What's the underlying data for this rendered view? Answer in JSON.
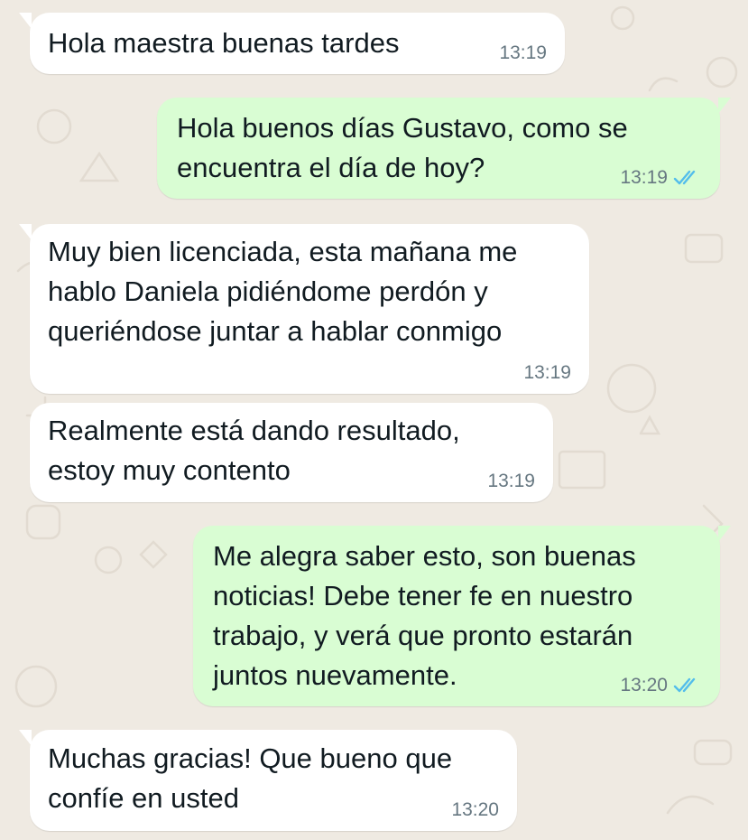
{
  "colors": {
    "background": "#efeae2",
    "incoming_bubble": "#ffffff",
    "outgoing_bubble": "#d9fdd3",
    "timestamp": "#667781",
    "read_ticks": "#53bdeb"
  },
  "messages": [
    {
      "direction": "incoming",
      "text": "Hola maestra buenas tardes",
      "time": "13:19"
    },
    {
      "direction": "outgoing",
      "text": "Hola buenos días Gustavo, como se\nencuentra el día de hoy?",
      "time": "13:19",
      "status": "read",
      "status_icon": "double-check-icon"
    },
    {
      "direction": "incoming",
      "text": "Muy bien licenciada, esta mañana me\nhablo Daniela pidiéndome perdón y\nqueriéndose juntar a hablar conmigo",
      "time": "13:19"
    },
    {
      "direction": "incoming",
      "text": "Realmente está dando resultado,\nestoy muy contento",
      "time": "13:19"
    },
    {
      "direction": "outgoing",
      "text": "Me alegra saber esto, son buenas\nnoticias! Debe tener fe en nuestro\ntrabajo, y verá que pronto estarán\njuntos nuevamente.",
      "time": "13:20",
      "status": "read",
      "status_icon": "double-check-icon"
    },
    {
      "direction": "incoming",
      "text": "Muchas gracias! Que bueno que\nconfíe en usted",
      "time": "13:20"
    }
  ]
}
